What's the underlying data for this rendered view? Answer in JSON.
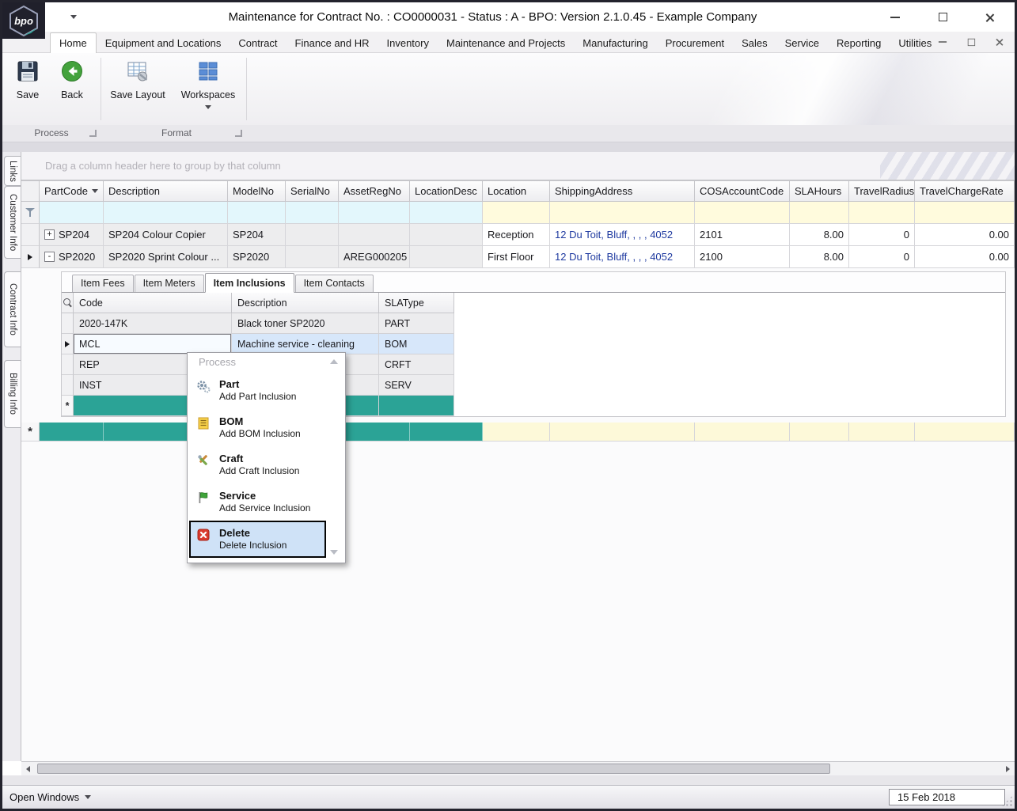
{
  "window": {
    "title": "Maintenance for Contract No. : CO0000031 - Status : A - BPO: Version 2.1.0.45 - Example Company",
    "logo_text": "bpo"
  },
  "ribbon": {
    "tabs": [
      {
        "label": "Home"
      },
      {
        "label": "Equipment and Locations"
      },
      {
        "label": "Contract"
      },
      {
        "label": "Finance and HR"
      },
      {
        "label": "Inventory"
      },
      {
        "label": "Maintenance and Projects"
      },
      {
        "label": "Manufacturing"
      },
      {
        "label": "Procurement"
      },
      {
        "label": "Sales"
      },
      {
        "label": "Service"
      },
      {
        "label": "Reporting"
      },
      {
        "label": "Utilities"
      }
    ],
    "buttons": {
      "save": "Save",
      "back": "Back",
      "save_layout": "Save Layout",
      "workspaces": "Workspaces"
    },
    "groups": {
      "process": "Process",
      "format": "Format"
    }
  },
  "sidebar": {
    "tabs": [
      {
        "label": "Links"
      },
      {
        "label": "Customer Info"
      },
      {
        "label": "Contract Info"
      },
      {
        "label": "Billing Info"
      }
    ]
  },
  "grid": {
    "group_hint": "Drag a column header here to group by that column",
    "columns": {
      "partcode": "PartCode",
      "description": "Description",
      "modelno": "ModelNo",
      "serialno": "SerialNo",
      "assetregno": "AssetRegNo",
      "locationdesc": "LocationDesc",
      "location": "Location",
      "shippingaddress": "ShippingAddress",
      "cosaccountcode": "COSAccountCode",
      "slahours": "SLAHours",
      "travelradius": "TravelRadius",
      "travelchargerate": "TravelChargeRate"
    },
    "rows": [
      {
        "expand": "+",
        "partcode": "SP204",
        "description": "SP204 Colour Copier",
        "modelno": "SP204",
        "serialno": "",
        "assetregno": "",
        "locationdesc": "",
        "location": "Reception",
        "shippingaddress": "12 Du Toit, Bluff, , , , 4052",
        "cosaccountcode": "2101",
        "slahours": "8.00",
        "travelradius": "0",
        "travelchargerate": "0.00"
      },
      {
        "expand": "-",
        "partcode": "SP2020",
        "description": "SP2020 Sprint Colour ...",
        "modelno": "SP2020",
        "serialno": "",
        "assetregno": "AREG000205",
        "locationdesc": "",
        "location": "First Floor",
        "shippingaddress": "12 Du Toit, Bluff, , , , 4052",
        "cosaccountcode": "2100",
        "slahours": "8.00",
        "travelradius": "0",
        "travelchargerate": "0.00"
      }
    ],
    "new_row_marker": "*"
  },
  "detail": {
    "tabs": [
      {
        "label": "Item Fees"
      },
      {
        "label": "Item Meters"
      },
      {
        "label": "Item Inclusions"
      },
      {
        "label": "Item Contacts"
      }
    ],
    "columns": {
      "code": "Code",
      "description": "Description",
      "slatype": "SLAType"
    },
    "rows": [
      {
        "code": "2020-147K",
        "description": "Black toner SP2020",
        "slatype": "PART"
      },
      {
        "code": "MCL",
        "description": "Machine service - cleaning",
        "slatype": "BOM"
      },
      {
        "code": "REP",
        "description": "",
        "slatype": "CRFT"
      },
      {
        "code": "INST",
        "description": "",
        "slatype": "SERV"
      }
    ],
    "new_row_marker": "*"
  },
  "context_menu": {
    "title": "Process",
    "items": [
      {
        "label": "Part",
        "sublabel": "Add Part Inclusion"
      },
      {
        "label": "BOM",
        "sublabel": "Add BOM Inclusion"
      },
      {
        "label": "Craft",
        "sublabel": "Add Craft Inclusion"
      },
      {
        "label": "Service",
        "sublabel": "Add Service Inclusion"
      },
      {
        "label": "Delete",
        "sublabel": "Delete Inclusion"
      }
    ]
  },
  "statusbar": {
    "open_windows": "Open Windows",
    "date": "15 Feb 2018"
  }
}
